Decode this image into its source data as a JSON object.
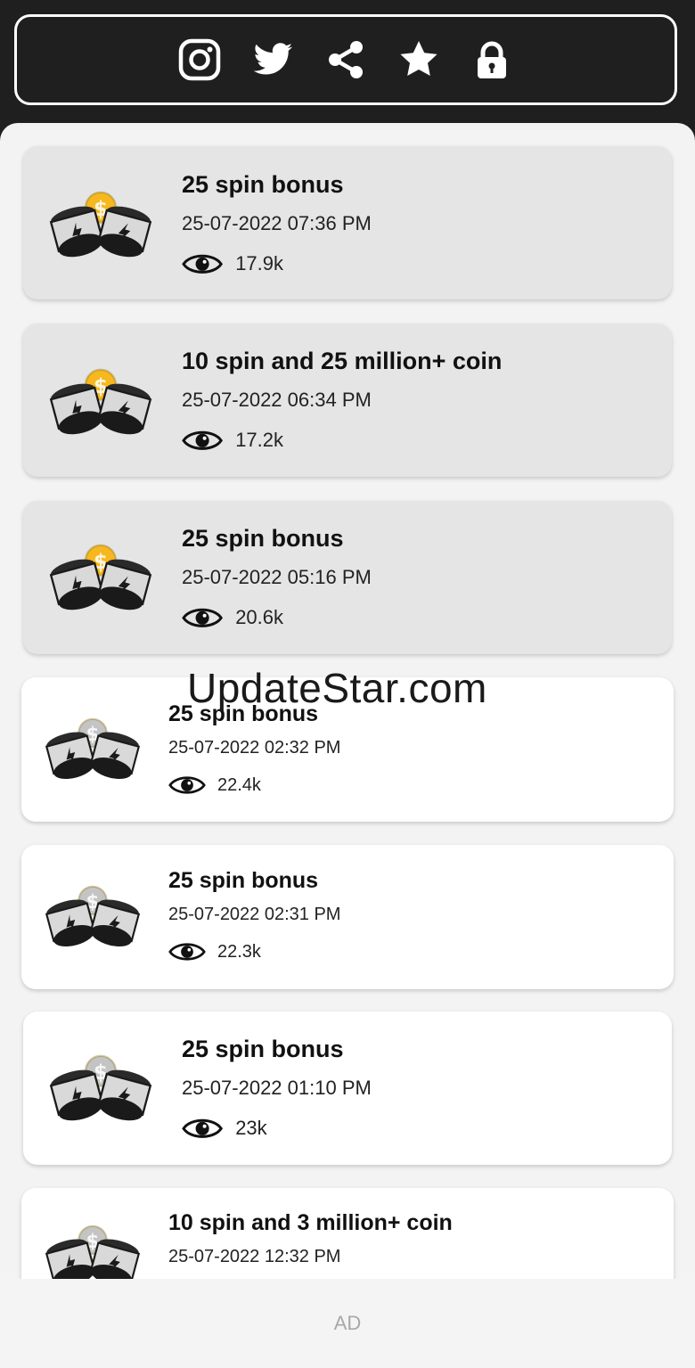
{
  "header": {
    "icons": [
      "instagram-icon",
      "twitter-icon",
      "share-icon",
      "star-icon",
      "lock-icon"
    ]
  },
  "posts": [
    {
      "title": "25 spin bonus",
      "date": "25-07-2022 07:36 PM",
      "views": "17.9k",
      "seen": true,
      "coin_color": "#f6b81e"
    },
    {
      "title": "10 spin and 25 million+ coin",
      "date": "25-07-2022 06:34 PM",
      "views": "17.2k",
      "seen": true,
      "coin_color": "#f6b81e"
    },
    {
      "title": "25 spin bonus",
      "date": "25-07-2022 05:16 PM",
      "views": "20.6k",
      "seen": true,
      "coin_color": "#f6b81e"
    },
    {
      "title": "25 spin bonus",
      "date": "25-07-2022 02:32 PM",
      "views": "22.4k",
      "seen": false,
      "coin_color": "#c4c4c4"
    },
    {
      "title": "25 spin bonus",
      "date": "25-07-2022 02:31 PM",
      "views": "22.3k",
      "seen": false,
      "coin_color": "#c4c4c4"
    },
    {
      "title": "25 spin bonus",
      "date": "25-07-2022 01:10 PM",
      "views": "23k",
      "seen": false,
      "coin_color": "#c4c4c4"
    },
    {
      "title": "10 spin and 3 million+ coin",
      "date": "25-07-2022 12:32 PM",
      "views": "",
      "seen": false,
      "coin_color": "#c4c4c4"
    }
  ],
  "watermark": "UpdateStar.com",
  "ad": {
    "label": "AD"
  }
}
